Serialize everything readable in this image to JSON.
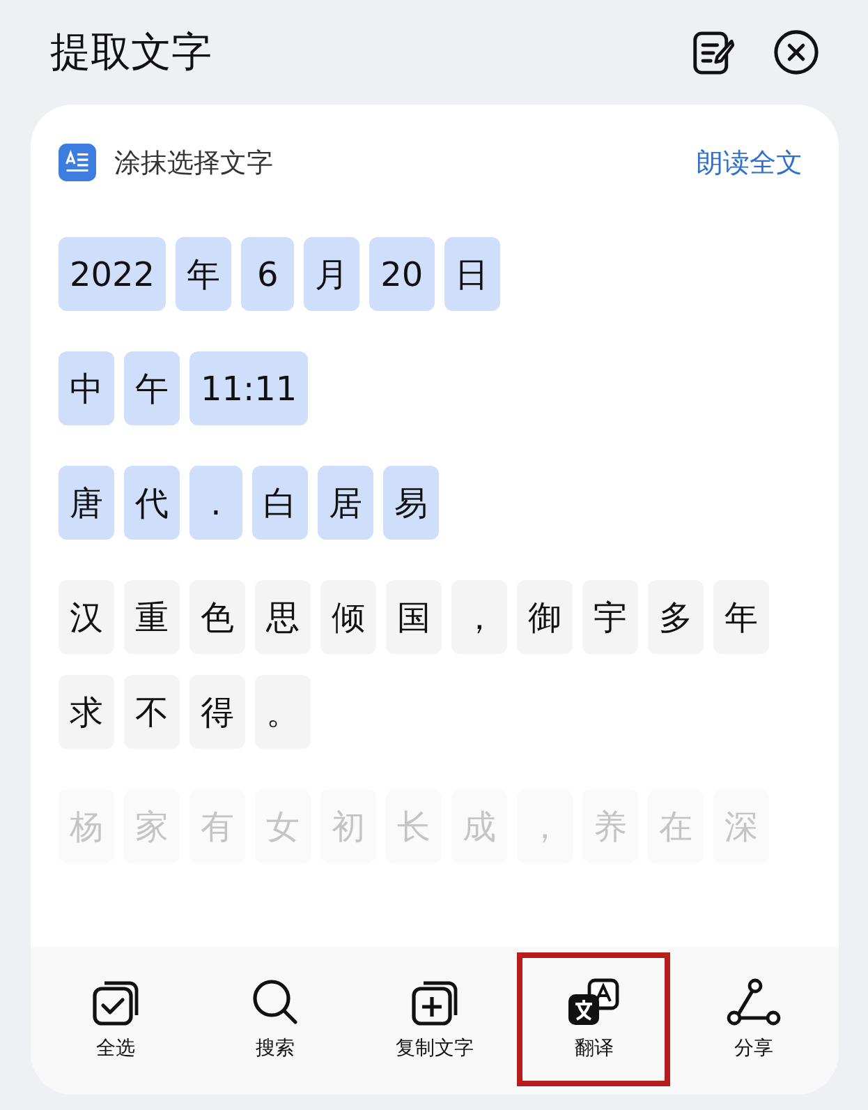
{
  "header": {
    "title": "提取文字"
  },
  "card": {
    "mode_label": "涂抹选择文字",
    "read_all": "朗读全文"
  },
  "lines": [
    {
      "faded": false,
      "tokens": [
        {
          "text": "2022",
          "selected": true
        },
        {
          "text": "年",
          "selected": true
        },
        {
          "text": "6",
          "selected": true
        },
        {
          "text": "月",
          "selected": true
        },
        {
          "text": "20",
          "selected": true
        },
        {
          "text": "日",
          "selected": true
        }
      ]
    },
    {
      "faded": false,
      "tokens": [
        {
          "text": "中",
          "selected": true
        },
        {
          "text": "午",
          "selected": true
        },
        {
          "text": "11:11",
          "selected": true
        }
      ]
    },
    {
      "faded": false,
      "tokens": [
        {
          "text": "唐",
          "selected": true
        },
        {
          "text": "代",
          "selected": true
        },
        {
          "text": ".",
          "selected": true
        },
        {
          "text": "白",
          "selected": true
        },
        {
          "text": "居",
          "selected": true
        },
        {
          "text": "易",
          "selected": true
        }
      ]
    },
    {
      "faded": false,
      "tokens": [
        {
          "text": "汉",
          "selected": false
        },
        {
          "text": "重",
          "selected": false
        },
        {
          "text": "色",
          "selected": false
        },
        {
          "text": "思",
          "selected": false
        },
        {
          "text": "倾",
          "selected": false
        },
        {
          "text": "国",
          "selected": false
        },
        {
          "text": "，",
          "selected": false
        },
        {
          "text": "御",
          "selected": false
        },
        {
          "text": "宇",
          "selected": false
        },
        {
          "text": "多",
          "selected": false
        },
        {
          "text": "年",
          "selected": false
        }
      ]
    },
    {
      "faded": false,
      "tokens": [
        {
          "text": "求",
          "selected": false
        },
        {
          "text": "不",
          "selected": false
        },
        {
          "text": "得",
          "selected": false
        },
        {
          "text": "。",
          "selected": false
        }
      ]
    },
    {
      "faded": true,
      "tokens": [
        {
          "text": "杨",
          "selected": false
        },
        {
          "text": "家",
          "selected": false
        },
        {
          "text": "有",
          "selected": false
        },
        {
          "text": "女",
          "selected": false
        },
        {
          "text": "初",
          "selected": false
        },
        {
          "text": "长",
          "selected": false
        },
        {
          "text": "成",
          "selected": false
        },
        {
          "text": "，",
          "selected": false
        },
        {
          "text": "养",
          "selected": false
        },
        {
          "text": "在",
          "selected": false
        },
        {
          "text": "深",
          "selected": false
        }
      ]
    }
  ],
  "toolbar": [
    {
      "kind": "select_all",
      "label": "全选",
      "highlighted": false
    },
    {
      "kind": "search",
      "label": "搜索",
      "highlighted": false
    },
    {
      "kind": "copy",
      "label": "复制文字",
      "highlighted": false
    },
    {
      "kind": "translate",
      "label": "翻译",
      "highlighted": true
    },
    {
      "kind": "share",
      "label": "分享",
      "highlighted": false
    }
  ]
}
